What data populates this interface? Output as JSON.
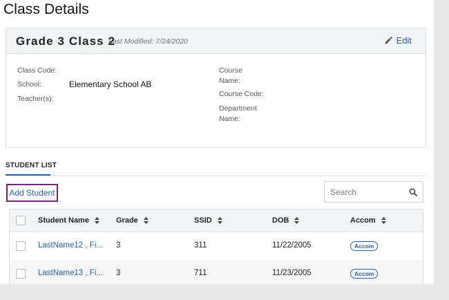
{
  "page": {
    "title": "Class Details"
  },
  "class_card": {
    "name": "Grade 3 Class 2",
    "last_modified": "Last Modified: 7/24/2020",
    "edit_label": "Edit",
    "fields_left": [
      {
        "label": "Class Code:",
        "value": ""
      },
      {
        "label": "School:",
        "value": "Elementary School AB"
      },
      {
        "label": "Teacher(s):",
        "value": ""
      }
    ],
    "fields_right": [
      {
        "label": "Course\nName:",
        "value": ""
      },
      {
        "label": "Course Code:",
        "value": ""
      },
      {
        "label": "Department\nName:",
        "value": ""
      }
    ]
  },
  "tabs": {
    "student_list": "STUDENT LIST"
  },
  "toolbar": {
    "add_student_label": "Add Student",
    "search_placeholder": "Search"
  },
  "table": {
    "columns": [
      "Student Name",
      "Grade",
      "SSID",
      "DOB",
      "Accom"
    ],
    "rows": [
      {
        "name": "LastName12 , Fi...",
        "grade": "3",
        "ssid": "311",
        "dob": "11/22/2005",
        "accom": "Accom"
      },
      {
        "name": "LastName13 , Fi...",
        "grade": "3",
        "ssid": "711",
        "dob": "11/23/2005",
        "accom": "Accom"
      }
    ]
  },
  "colors": {
    "accent": "#2b5ea8",
    "highlight_border": "#7a1f7a",
    "header_bg": "#f2f3f4"
  }
}
